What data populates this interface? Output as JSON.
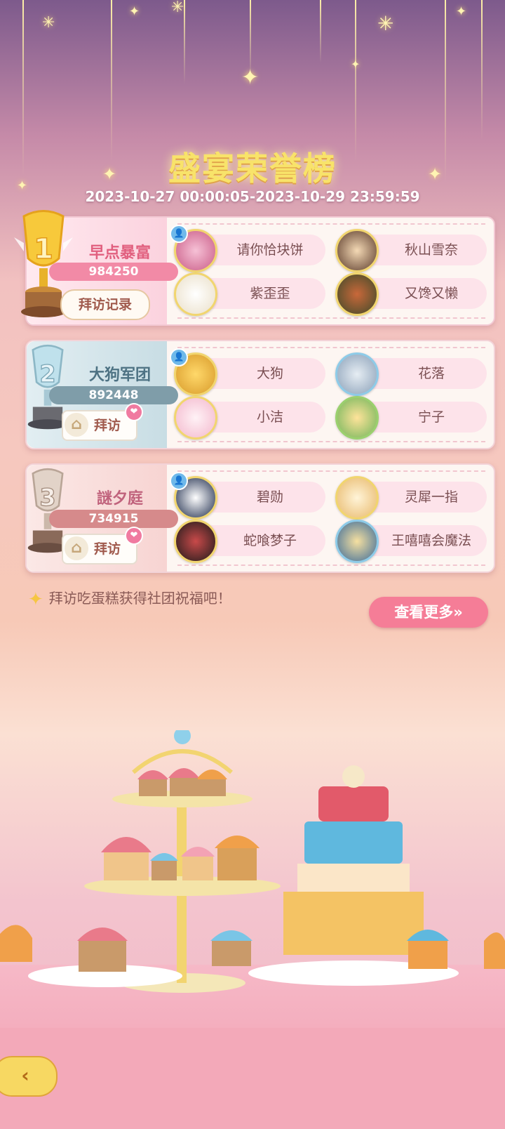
{
  "title": "盛宴荣誉榜",
  "date_range": "2023-10-27 00:00:05-2023-10-29 23:59:59",
  "ranks": [
    {
      "rank": "1",
      "team_name": "早点暴富",
      "score": "984250",
      "action_label": "拜访记录",
      "members": [
        "请你恰块饼",
        "秋山雪奈",
        "紫歪歪",
        "又馋又懒"
      ]
    },
    {
      "rank": "2",
      "team_name": "大狗军团",
      "score": "892448",
      "action_label": "拜访",
      "members": [
        "大狗",
        "花落",
        "小洁",
        "宁子"
      ]
    },
    {
      "rank": "3",
      "team_name": "謎夕庭",
      "score": "734915",
      "action_label": "拜访",
      "members": [
        "碧勋",
        "灵犀一指",
        "蛇喰梦子",
        "王嘻嘻会魔法"
      ]
    }
  ],
  "tip": "拜访吃蛋糕获得社团祝福吧！",
  "more_button": "查看更多»",
  "colors": {
    "gold": "#f8e36a",
    "pink_button": "#f57d97",
    "silver": "#7f9da9",
    "bronze": "#d68a8b"
  }
}
